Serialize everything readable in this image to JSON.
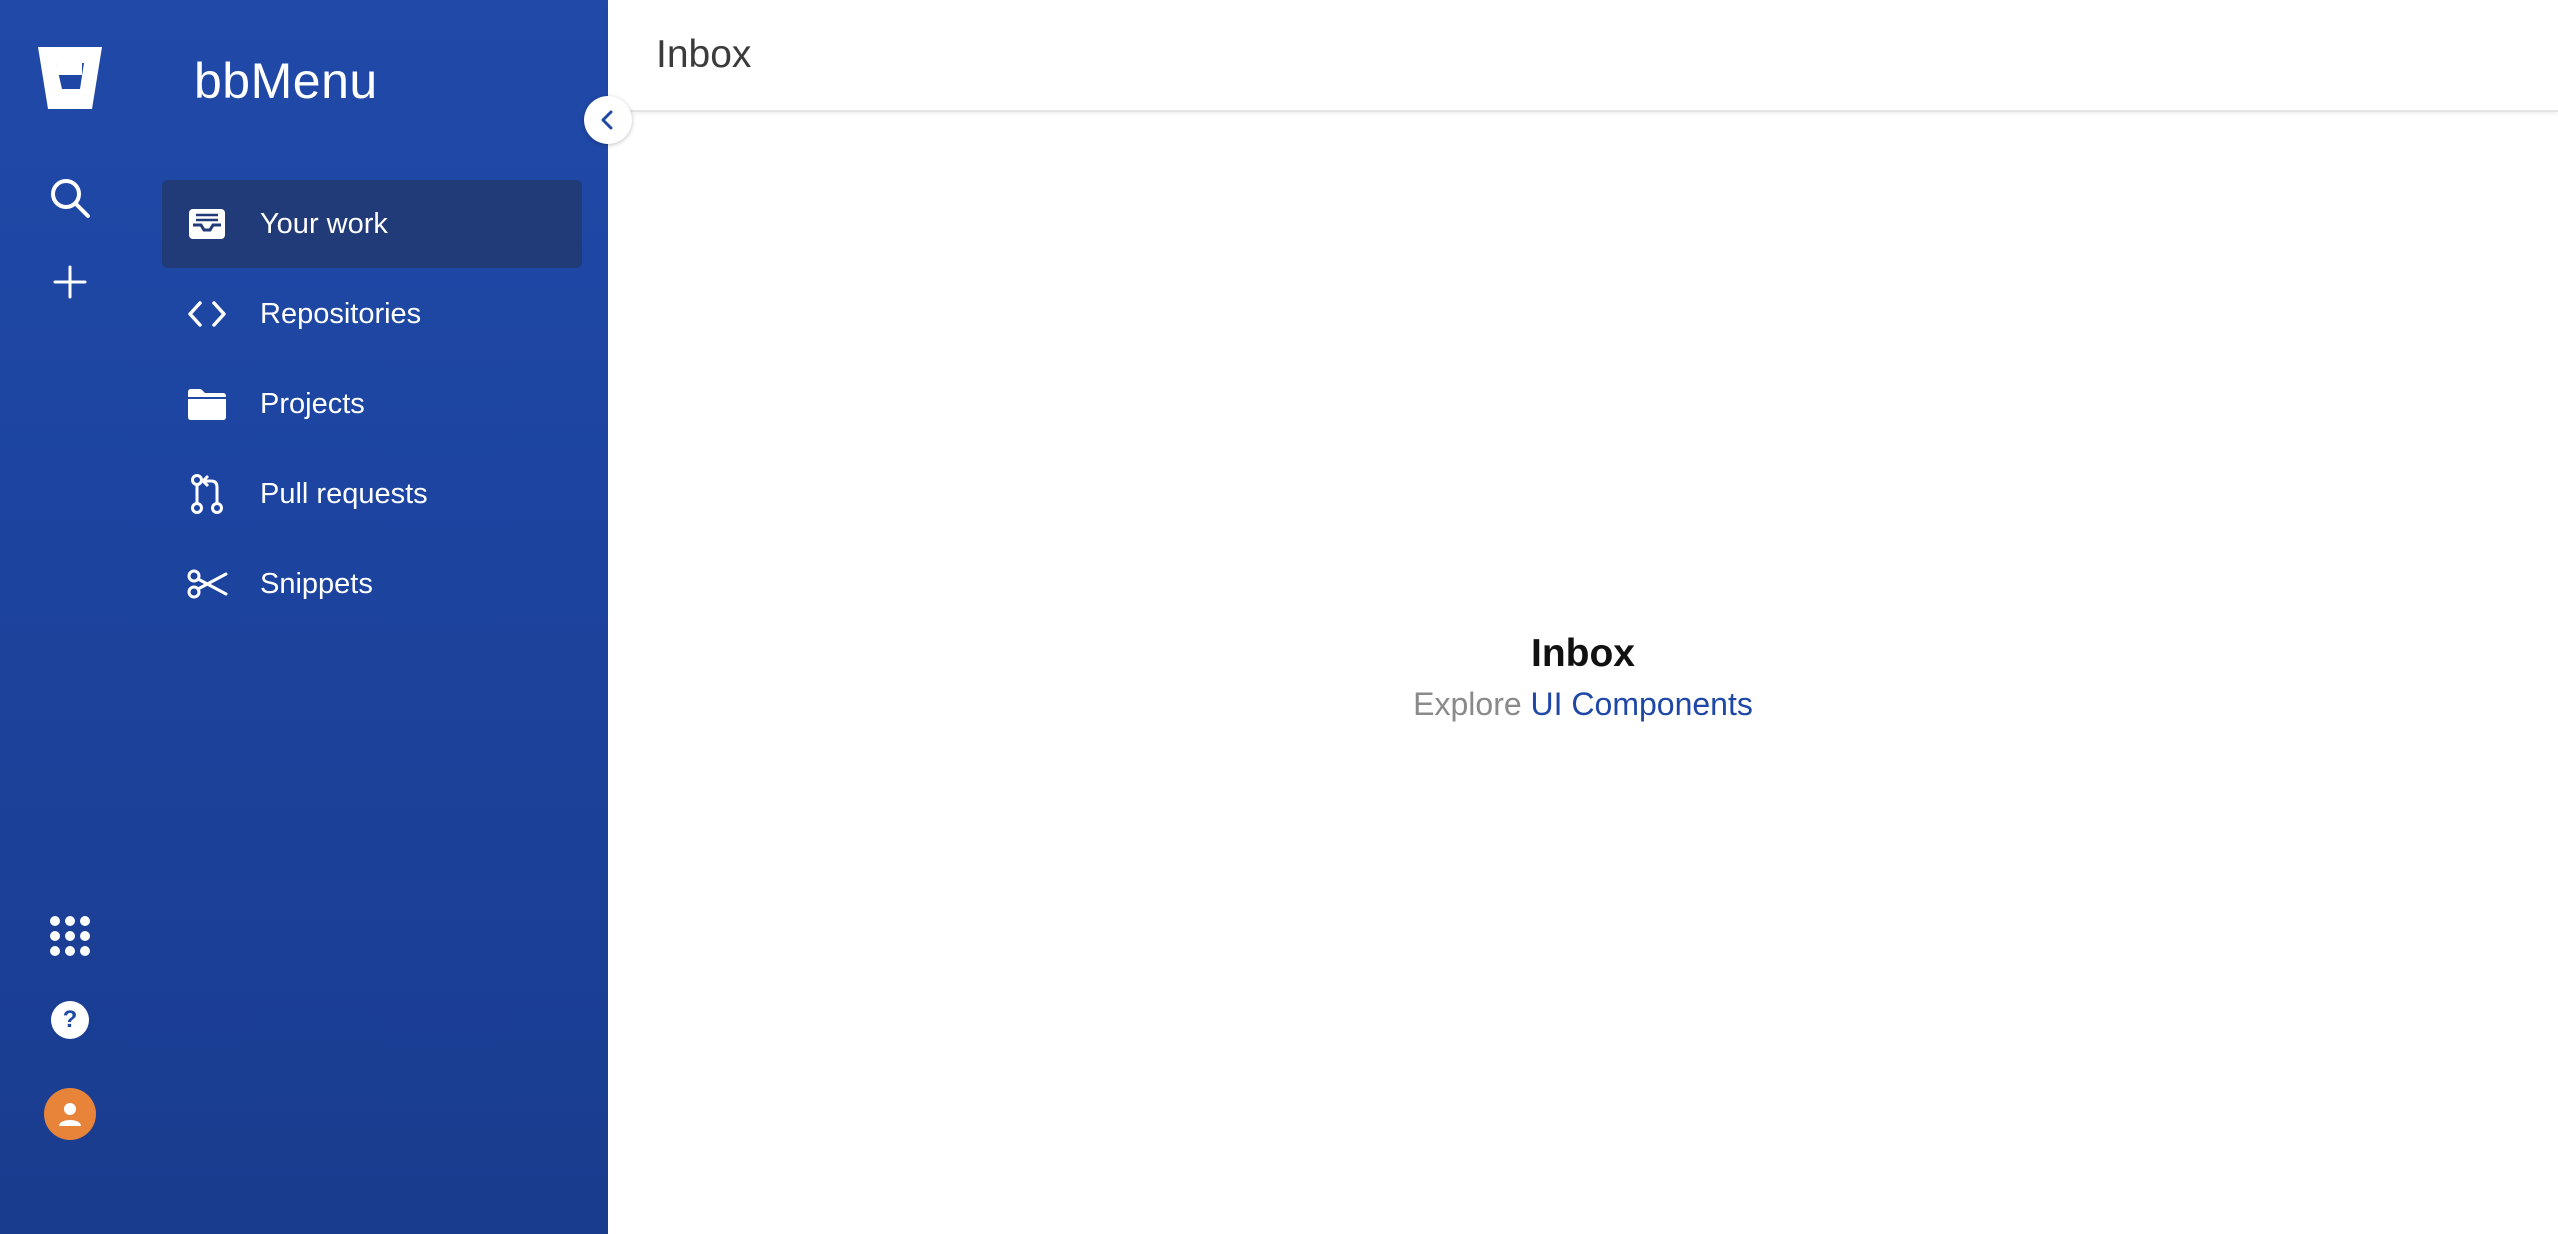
{
  "product": {
    "title": "bbMenu"
  },
  "rail": {
    "logo_icon": "bitbucket-logo-icon",
    "search_icon": "search-icon",
    "create_icon": "plus-icon",
    "apps_icon": "grid-icon",
    "help_icon": "help-icon",
    "help_glyph": "?",
    "avatar_icon": "user-avatar-icon"
  },
  "nav": {
    "items": [
      {
        "label": "Your work",
        "icon": "inbox-icon",
        "active": true
      },
      {
        "label": "Repositories",
        "icon": "code-icon",
        "active": false
      },
      {
        "label": "Projects",
        "icon": "folder-icon",
        "active": false
      },
      {
        "label": "Pull requests",
        "icon": "pull-request-icon",
        "active": false
      },
      {
        "label": "Snippets",
        "icon": "scissors-icon",
        "active": false
      }
    ]
  },
  "header": {
    "title": "Inbox"
  },
  "empty_state": {
    "title": "Inbox",
    "explore_text": "Explore",
    "link_text": "UI Components"
  },
  "colors": {
    "sidebar": "#1f47a6",
    "active_item": "#213a78",
    "link": "#1f47a6",
    "avatar": "#e8833a"
  }
}
